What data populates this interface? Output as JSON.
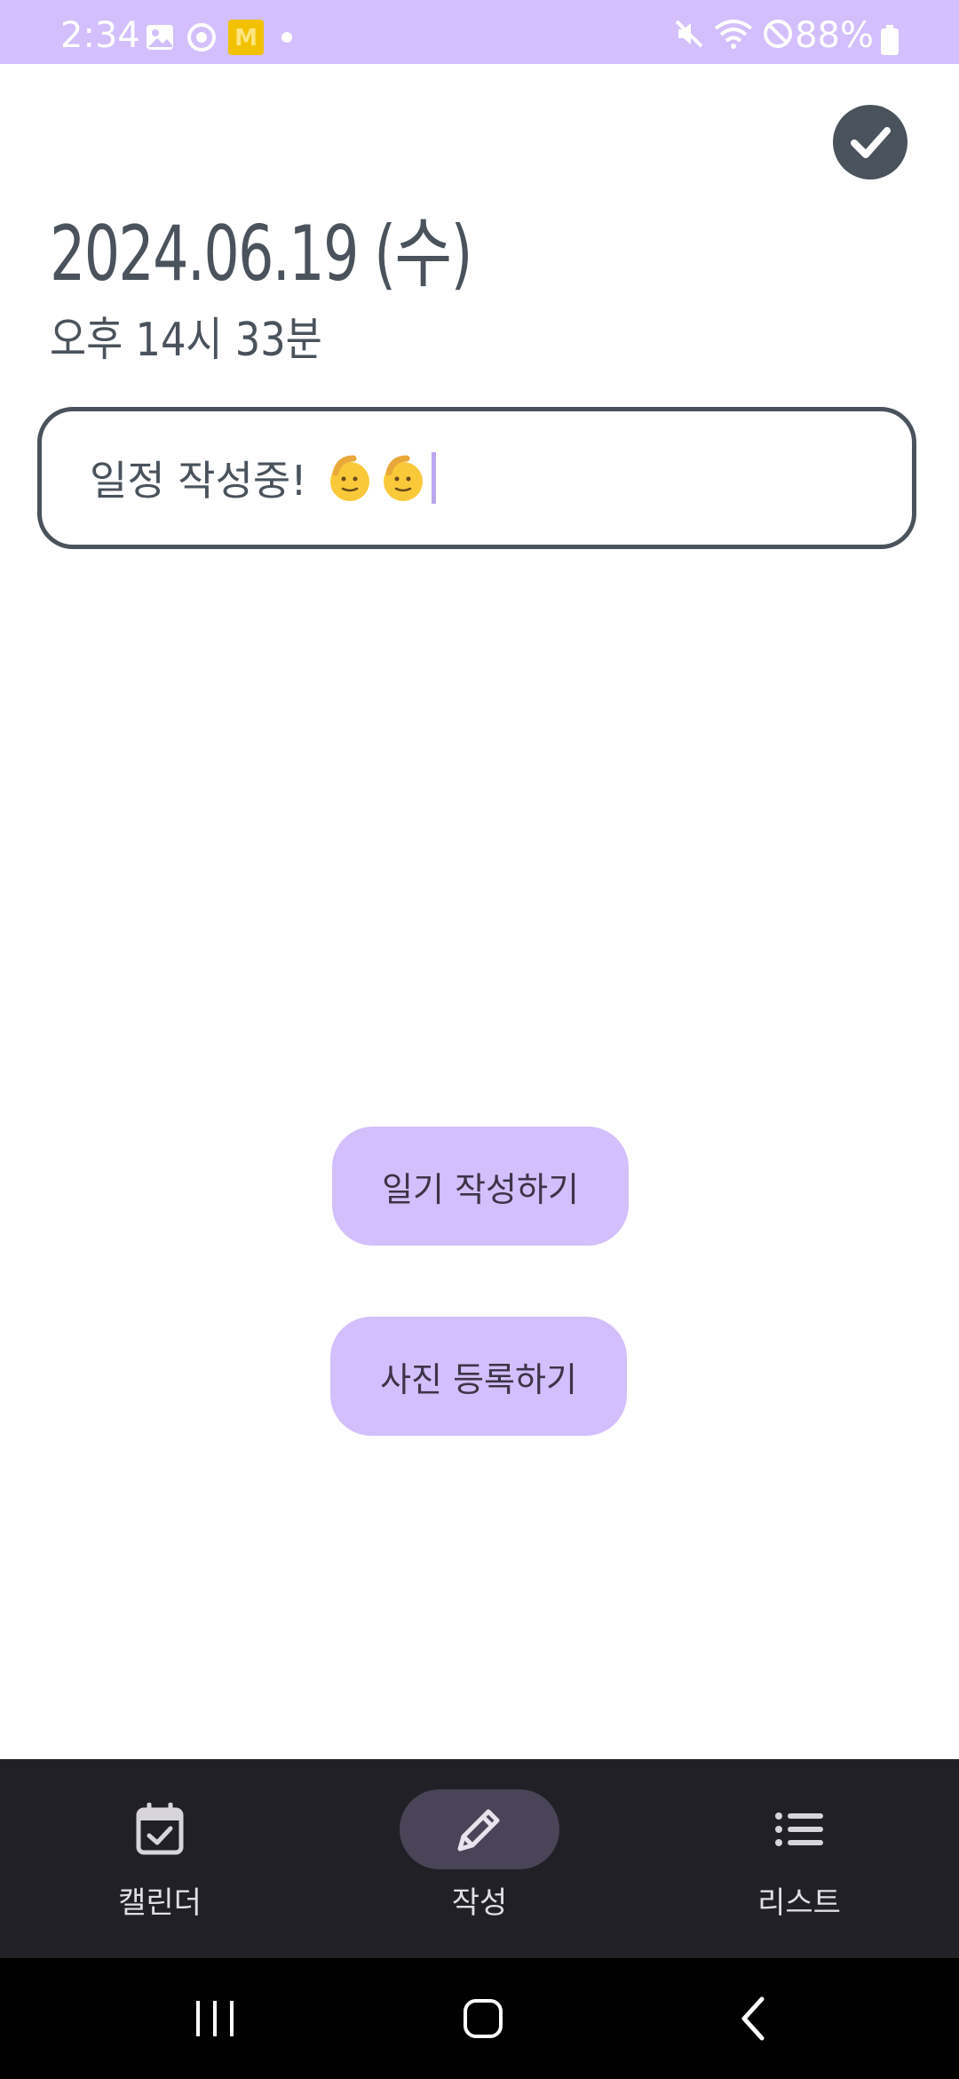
{
  "status_bar": {
    "time": "2:34",
    "battery": "88%",
    "background_color": "#d3bffc",
    "left_icons": [
      "gallery-icon",
      "sync-icon",
      "m-badge-icon",
      "dot-icon"
    ],
    "right_icons": [
      "mute-icon",
      "wifi-icon",
      "do-not-disturb-icon",
      "battery-icon"
    ]
  },
  "header": {
    "date": "2024.06.19 (수)",
    "time": "오후 14시 33분",
    "confirm_icon": "check-icon"
  },
  "schedule_input": {
    "value": "일정 작성중!",
    "emoji": "saluting-face-emoji",
    "emoji_count": 2
  },
  "actions": {
    "write_diary": "일기 작성하기",
    "register_photo": "사진 등록하기"
  },
  "bottom_nav": {
    "items": [
      {
        "label": "캘린더",
        "icon": "calendar-check-icon",
        "active": false
      },
      {
        "label": "작성",
        "icon": "pencil-icon",
        "active": true
      },
      {
        "label": "리스트",
        "icon": "list-icon",
        "active": false
      }
    ]
  },
  "colors": {
    "accent": "#d3bffc",
    "text_dark": "#4a535c",
    "nav_background": "#212027",
    "nav_active_pill": "#4a4458"
  }
}
